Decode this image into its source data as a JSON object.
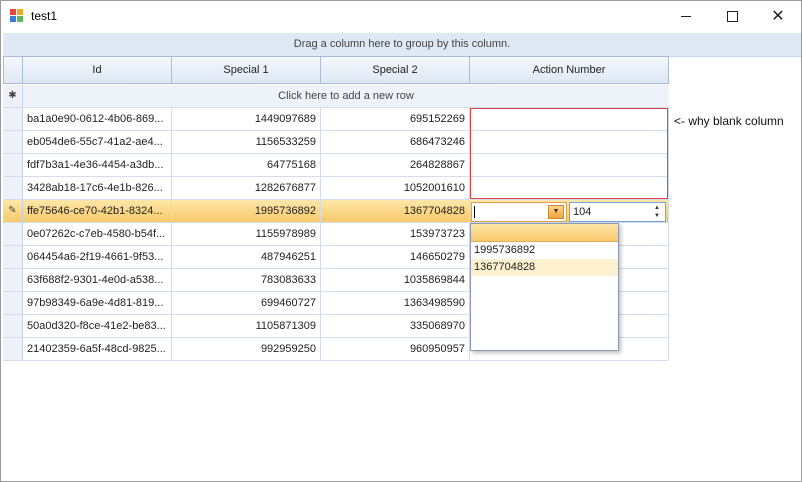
{
  "window": {
    "title": "test1",
    "controls": {
      "minimize": "",
      "maximize": "",
      "close": "✕"
    }
  },
  "group_panel": {
    "text": "Drag a column here to group by this column."
  },
  "columns": [
    "Id",
    "Special 1",
    "Special 2",
    "Action Number"
  ],
  "new_row": {
    "indicator": "✱",
    "text": "Click here to add a new row"
  },
  "rows": [
    {
      "id": "ba1a0e90-0612-4b06-869...",
      "s1": "1449097689",
      "s2": "695152269",
      "action": ""
    },
    {
      "id": "eb054de6-55c7-41a2-ae4...",
      "s1": "1156533259",
      "s2": "686473246",
      "action": ""
    },
    {
      "id": "fdf7b3a1-4e36-4454-a3db...",
      "s1": "64775168",
      "s2": "264828867",
      "action": ""
    },
    {
      "id": "3428ab18-17c6-4e1b-826...",
      "s1": "1282676877",
      "s2": "1052001610",
      "action": ""
    },
    {
      "id": "ffe75646-ce70-42b1-8324...",
      "s1": "1995736892",
      "s2": "1367704828",
      "action": "",
      "selected": true,
      "indicator": "✎"
    },
    {
      "id": "0e07262c-c7eb-4580-b54f...",
      "s1": "1155978989",
      "s2": "153973723",
      "action": ""
    },
    {
      "id": "064454a6-2f19-4661-9f53...",
      "s1": "487946251",
      "s2": "146650279",
      "action": ""
    },
    {
      "id": "63f688f2-9301-4e0d-a538...",
      "s1": "783083633",
      "s2": "1035869844",
      "action": ""
    },
    {
      "id": "97b98349-6a9e-4d81-819...",
      "s1": "699460727",
      "s2": "1363498590",
      "action": ""
    },
    {
      "id": "50a0d320-f8ce-41e2-be83...",
      "s1": "1105871309",
      "s2": "335068970",
      "action": ""
    },
    {
      "id": "21402359-6a5f-48cd-9825...",
      "s1": "992959250",
      "s2": "960950957",
      "action": ""
    }
  ],
  "editor": {
    "combo_value": "",
    "spin_value": "104",
    "dropdown_options": [
      "",
      "1995736892",
      "1367704828"
    ]
  },
  "annotation": {
    "text": "<- why blank column"
  },
  "colors": {
    "selected_row": "#f8c96a",
    "red_box": "#e04040",
    "header_bg": "#dde7f4"
  }
}
